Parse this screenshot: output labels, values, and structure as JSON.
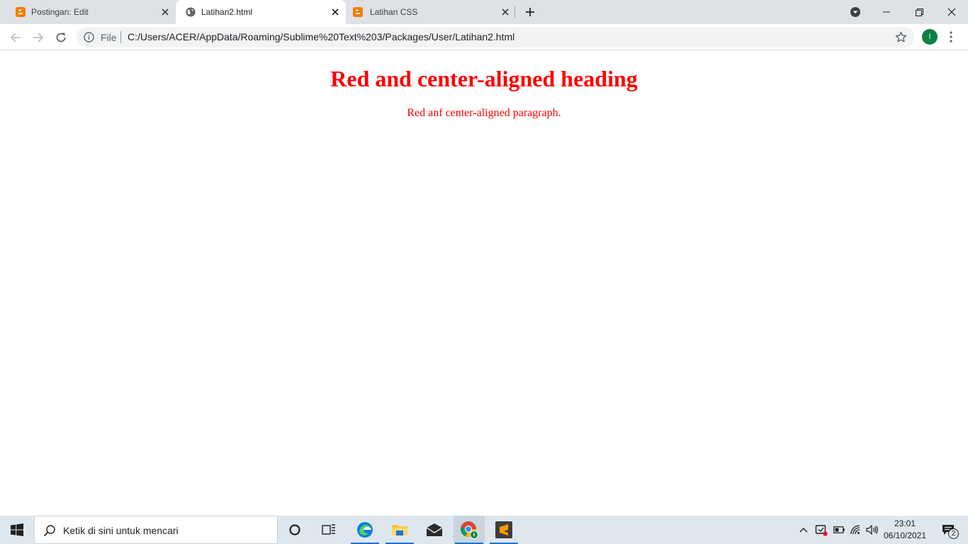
{
  "browser": {
    "tabs": [
      {
        "title": "Postingan: Edit",
        "icon": "blogger-icon",
        "active": false
      },
      {
        "title": "Latihan2.html",
        "icon": "globe-icon",
        "active": true
      },
      {
        "title": "Latihan CSS",
        "icon": "blogger-icon",
        "active": false
      }
    ],
    "omnibox": {
      "scheme_label": "File",
      "url": "C:/Users/ACER/AppData/Roaming/Sublime%20Text%203/Packages/User/Latihan2.html"
    },
    "profile_initial": "I",
    "colors": {
      "tabstrip": "#dee1e6",
      "omnibox": "#f1f3f4",
      "profile": "#0b8043",
      "blogger": "#f57d00"
    }
  },
  "page": {
    "heading": "Red and center-aligned heading",
    "paragraph": "Red anf center-aligned paragraph.",
    "text_color": "#ff0000"
  },
  "taskbar": {
    "search_placeholder": "Ketik di sini untuk mencari",
    "apps": [
      "cortana-icon",
      "task-view-icon",
      "edge-icon",
      "file-explorer-icon",
      "mail-icon",
      "chrome-icon",
      "sublime-text-icon"
    ],
    "tray_icons": [
      "chevron-up-icon",
      "defender-icon",
      "battery-icon",
      "wifi-icon",
      "volume-icon"
    ],
    "time": "23:01",
    "date": "06/10/2021",
    "notification_count": "2"
  }
}
